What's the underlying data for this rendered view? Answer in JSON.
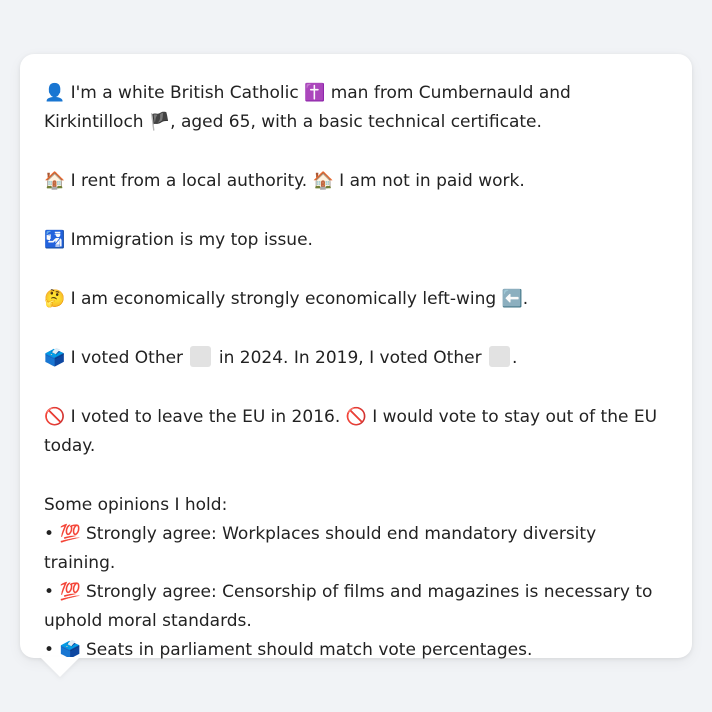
{
  "profile": {
    "identity": {
      "icon": "👤",
      "icon_name": "person-silhouette-icon",
      "text_a": "I'm a white British Catholic",
      "religion_icon": "✝️",
      "text_b": "man from Cumbernauld and Kirkintilloch",
      "region_icon": "🏴",
      "text_c": ", aged 65, with a basic technical certificate."
    },
    "housing": {
      "icon1": "🏠",
      "text1": "I rent from a local authority.",
      "icon2": "🏠",
      "text2": "I am not in paid work."
    },
    "issue": {
      "icon": "🛂",
      "text": "Immigration is my top issue."
    },
    "economics": {
      "icon": "🤔",
      "text": "I am economically strongly economically left-wing",
      "dir_icon": "⬅️",
      "suffix": "."
    },
    "votes": {
      "icon": "🗳️",
      "text_a": "I voted Other",
      "text_b": "in 2024. In 2019, I voted Other",
      "suffix": ".",
      "party_color": "#e2e2e2"
    },
    "eu": {
      "icon1": "🚫",
      "text1": "I voted to leave the EU in 2016.",
      "icon2": "🚫",
      "text2": "I would vote to stay out of the EU today."
    },
    "opinions": {
      "title": "Some opinions I hold:",
      "items": [
        {
          "bullet": "•",
          "icon": "💯",
          "text": "Strongly agree: Workplaces should end mandatory diversity training."
        },
        {
          "bullet": "•",
          "icon": "💯",
          "text": "Strongly agree: Censorship of films and magazines is necessary to uphold moral standards."
        },
        {
          "bullet": "•",
          "icon": "🗳️",
          "text": "Seats in parliament should match vote percentages."
        }
      ]
    }
  }
}
